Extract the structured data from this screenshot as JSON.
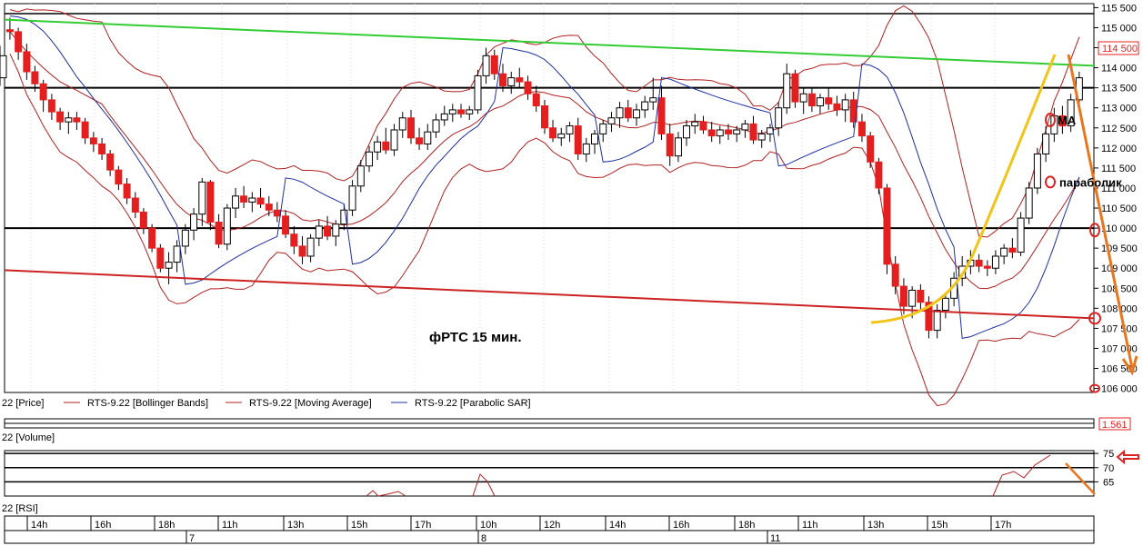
{
  "chart_data": [
    {
      "type": "candlestick",
      "panel": "price",
      "title": "фРТС   15 мин.",
      "y_ticks": [
        106000,
        106500,
        107000,
        107500,
        108000,
        108500,
        109000,
        109500,
        110000,
        110500,
        111000,
        111500,
        112000,
        112500,
        113000,
        113500,
        114000,
        114500,
        115000,
        115500
      ],
      "y_tick_labels": [
        "106 000",
        "106 500",
        "107 000",
        "107 500",
        "108 000",
        "108 500",
        "109 000",
        "109 500",
        "110 000",
        "110 500",
        "111 000",
        "111 500",
        "112 000",
        "112 500",
        "113 000",
        "113 500",
        "114 000",
        "114 500",
        "115 000",
        "115 500"
      ],
      "ylim": [
        105900,
        115600
      ],
      "last_price_label": "114 500",
      "last_price": 114500,
      "horizontal_levels": [
        115350,
        113500,
        110000
      ],
      "trendlines": [
        {
          "color": "#33cc33",
          "from": [
            0,
            115200
          ],
          "to": [
            158,
            114050
          ]
        },
        {
          "color": "#cc2222",
          "from": [
            0,
            108950
          ],
          "to": [
            158,
            107750
          ]
        }
      ],
      "series_legend": [
        {
          "name": "22 [Price]"
        },
        {
          "name": "RTS-9.22 [Bollinger Bands]",
          "color": "#b02020"
        },
        {
          "name": "RTS-9.22 [Moving Average]",
          "color": "#b02020"
        },
        {
          "name": "RTS-9.22 [Parabolic SAR]",
          "color": "#1f2fa0"
        }
      ],
      "annotations": [
        {
          "text": "МА",
          "x": 151,
          "y": 112700
        },
        {
          "text": "параболик",
          "x": 151,
          "y": 111150
        }
      ],
      "candles_ohlc": [
        [
          114950,
          115250,
          114700,
          114900
        ],
        [
          114900,
          115000,
          114200,
          114400
        ],
        [
          114400,
          114600,
          113700,
          113900
        ],
        [
          113900,
          114050,
          113400,
          113600
        ],
        [
          113600,
          113700,
          112900,
          113200
        ],
        [
          113200,
          113350,
          112700,
          112900
        ],
        [
          112900,
          113000,
          112450,
          112650
        ],
        [
          112650,
          112900,
          112350,
          112750
        ],
        [
          112750,
          112900,
          112450,
          112650
        ],
        [
          112650,
          112750,
          112100,
          112250
        ],
        [
          112250,
          112400,
          111900,
          112100
        ],
        [
          112100,
          112250,
          111700,
          111850
        ],
        [
          111850,
          111950,
          111300,
          111450
        ],
        [
          111450,
          111550,
          110950,
          111100
        ],
        [
          111100,
          111250,
          110600,
          110750
        ],
        [
          110750,
          110900,
          110250,
          110400
        ],
        [
          110400,
          110500,
          109850,
          110000
        ],
        [
          110000,
          110100,
          109400,
          109500
        ],
        [
          109500,
          109600,
          108900,
          109000
        ],
        [
          109000,
          109400,
          108600,
          109150
        ],
        [
          109150,
          109700,
          108900,
          109550
        ],
        [
          109550,
          110100,
          109350,
          109950
        ],
        [
          109950,
          110500,
          109700,
          110350
        ],
        [
          110350,
          111250,
          110050,
          111150
        ],
        [
          111150,
          111200,
          109950,
          110150
        ],
        [
          110150,
          110350,
          109500,
          109600
        ],
        [
          109600,
          110600,
          109450,
          110500
        ],
        [
          110500,
          111000,
          110250,
          110800
        ],
        [
          110800,
          111050,
          110500,
          110650
        ],
        [
          110650,
          110900,
          110400,
          110750
        ],
        [
          110750,
          111000,
          110500,
          110600
        ],
        [
          110600,
          110800,
          110300,
          110450
        ],
        [
          110450,
          110650,
          110150,
          110300
        ],
        [
          110300,
          110450,
          109750,
          109850
        ],
        [
          109850,
          110050,
          109350,
          109550
        ],
        [
          109550,
          109800,
          109100,
          109300
        ],
        [
          109300,
          109850,
          109150,
          109750
        ],
        [
          109750,
          110200,
          109550,
          110050
        ],
        [
          110050,
          110300,
          109700,
          109800
        ],
        [
          109800,
          110200,
          109550,
          110100
        ],
        [
          110100,
          110600,
          109950,
          110450
        ],
        [
          110450,
          111200,
          110300,
          111050
        ],
        [
          111050,
          111700,
          110900,
          111550
        ],
        [
          111550,
          112050,
          111400,
          111900
        ],
        [
          111900,
          112300,
          111700,
          112150
        ],
        [
          112150,
          112500,
          111850,
          111950
        ],
        [
          111950,
          112600,
          111800,
          112450
        ],
        [
          112450,
          112900,
          112250,
          112750
        ],
        [
          112750,
          112950,
          112100,
          112250
        ],
        [
          112250,
          112500,
          111950,
          112100
        ],
        [
          112100,
          112600,
          111950,
          112400
        ],
        [
          112400,
          112850,
          112250,
          112700
        ],
        [
          112700,
          113050,
          112550,
          112850
        ],
        [
          112850,
          113100,
          112650,
          112950
        ],
        [
          112950,
          113100,
          112750,
          112850
        ],
        [
          112850,
          113050,
          112700,
          112950
        ],
        [
          112950,
          113950,
          112850,
          113800
        ],
        [
          113800,
          114500,
          113600,
          114300
        ],
        [
          114300,
          114450,
          113700,
          113850
        ],
        [
          113850,
          114100,
          113400,
          113550
        ],
        [
          113550,
          113900,
          113350,
          113750
        ],
        [
          113750,
          114000,
          113500,
          113650
        ],
        [
          113650,
          113800,
          113200,
          113350
        ],
        [
          113350,
          113550,
          112900,
          113050
        ],
        [
          113050,
          113200,
          112350,
          112500
        ],
        [
          112500,
          112700,
          112150,
          112250
        ],
        [
          112250,
          112500,
          112050,
          112350
        ],
        [
          112350,
          112650,
          112150,
          112550
        ],
        [
          112550,
          112750,
          111700,
          111850
        ],
        [
          111850,
          112250,
          111650,
          112100
        ],
        [
          112100,
          112450,
          111850,
          112350
        ],
        [
          112350,
          112700,
          112150,
          112600
        ],
        [
          112600,
          112900,
          112400,
          112750
        ],
        [
          112750,
          113150,
          112500,
          113000
        ],
        [
          113000,
          113200,
          112650,
          112750
        ],
        [
          112750,
          113100,
          112550,
          112950
        ],
        [
          112950,
          113300,
          112750,
          113150
        ],
        [
          113150,
          113750,
          112950,
          113250
        ],
        [
          113250,
          113550,
          112200,
          112350
        ],
        [
          112350,
          112600,
          111550,
          111800
        ],
        [
          111800,
          112400,
          111650,
          112250
        ],
        [
          112250,
          112700,
          112050,
          112550
        ],
        [
          112550,
          112850,
          112350,
          112650
        ],
        [
          112650,
          112800,
          112350,
          112450
        ],
        [
          112450,
          112650,
          112150,
          112300
        ],
        [
          112300,
          112550,
          112100,
          112450
        ],
        [
          112450,
          112600,
          112200,
          112350
        ],
        [
          112350,
          112550,
          112150,
          112450
        ],
        [
          112450,
          112700,
          112250,
          112600
        ],
        [
          112600,
          112800,
          112100,
          112200
        ],
        [
          112200,
          112450,
          112000,
          112350
        ],
        [
          112350,
          112600,
          112150,
          112500
        ],
        [
          112500,
          113150,
          112300,
          113000
        ],
        [
          113000,
          114100,
          112850,
          113850
        ],
        [
          113850,
          113950,
          113000,
          113150
        ],
        [
          113150,
          113500,
          112850,
          113350
        ],
        [
          113350,
          113500,
          112900,
          113050
        ],
        [
          113050,
          113350,
          112850,
          113250
        ],
        [
          113250,
          113500,
          112950,
          113100
        ],
        [
          113100,
          113300,
          112800,
          112950
        ],
        [
          112950,
          113350,
          112650,
          113200
        ],
        [
          113200,
          113400,
          112500,
          112650
        ],
        [
          112650,
          112850,
          112150,
          112300
        ],
        [
          112300,
          112400,
          111500,
          111650
        ],
        [
          111650,
          111750,
          110850,
          111000
        ],
        [
          111000,
          111100,
          108850,
          109100
        ],
        [
          109100,
          109300,
          108350,
          108550
        ],
        [
          108550,
          108750,
          107850,
          108050
        ],
        [
          108050,
          108550,
          107750,
          108450
        ],
        [
          108450,
          108600,
          107950,
          108150
        ],
        [
          108150,
          108300,
          107250,
          107450
        ],
        [
          107450,
          108100,
          107250,
          107950
        ],
        [
          107950,
          108400,
          107750,
          108250
        ],
        [
          108250,
          108900,
          108050,
          108750
        ],
        [
          108750,
          109300,
          108550,
          109050
        ],
        [
          109050,
          109450,
          108850,
          109200
        ],
        [
          109200,
          109350,
          108900,
          109050
        ],
        [
          109050,
          109200,
          108800,
          109000
        ],
        [
          109000,
          109450,
          108850,
          109300
        ],
        [
          109300,
          109600,
          109100,
          109500
        ],
        [
          109500,
          109750,
          109250,
          109400
        ],
        [
          109400,
          110400,
          109300,
          110250
        ],
        [
          110250,
          111150,
          110100,
          111000
        ],
        [
          111000,
          112000,
          110850,
          111850
        ],
        [
          111850,
          112550,
          111650,
          112350
        ],
        [
          112350,
          113000,
          112150,
          112800
        ],
        [
          112800,
          113050,
          112350,
          112550
        ],
        [
          112550,
          113350,
          112400,
          113200
        ],
        [
          113200,
          113900,
          113000,
          113750
        ],
        [
          113750,
          114550,
          113550,
          114300
        ]
      ],
      "x_candle_positions": [
        0.05,
        0.56,
        1.07,
        1.57,
        2.08,
        2.59,
        3.1,
        3.61,
        4.11,
        4.62,
        5.13,
        5.64,
        6.14,
        6.65,
        7.16,
        7.67,
        8.17,
        8.68,
        9.19,
        9.7,
        10.2,
        10.71,
        11.22,
        11.73,
        12.23,
        12.74,
        13.25,
        13.76,
        14.26,
        14.77,
        15.28,
        15.79,
        16.29,
        16.8,
        17.31,
        17.82,
        18.32,
        18.83,
        19.34,
        19.85,
        20.35,
        20.86,
        21.37,
        21.88,
        22.38,
        22.89,
        23.4,
        23.91,
        24.42,
        24.92,
        25.43,
        25.94,
        26.45,
        26.95,
        27.46,
        27.97,
        28.48,
        28.98,
        29.49,
        30.0,
        30.51,
        31.01,
        31.52,
        32.03,
        32.54,
        33.04,
        33.55,
        34.06,
        34.57,
        35.07,
        35.58,
        36.09,
        36.6,
        37.1,
        37.61,
        38.12,
        38.63,
        39.13,
        39.64,
        40.15,
        40.66,
        41.16,
        41.67,
        42.18,
        42.69,
        43.19,
        43.7,
        44.21,
        44.72,
        45.22,
        45.73,
        46.24,
        46.75,
        47.25,
        47.76,
        48.27,
        48.78,
        49.28,
        49.79,
        50.3,
        50.81,
        51.31,
        51.82,
        52.33,
        52.84,
        53.34,
        53.85,
        54.36,
        54.87,
        55.38,
        55.88,
        56.39,
        56.9,
        57.41,
        57.91,
        58.42,
        58.93,
        59.44,
        59.94,
        60.45,
        60.96,
        61.47,
        61.97,
        62.48,
        62.99,
        63.5,
        64.0,
        64.51,
        65.02
      ]
    },
    {
      "type": "line",
      "panel": "volume",
      "title": "22 [Volume]",
      "last_value_label": "1.561",
      "last_value": 1.561
    },
    {
      "type": "line",
      "panel": "rsi",
      "title": "22 [RSI]",
      "y_ticks": [
        65,
        70,
        75
      ],
      "y_tick_labels": [
        "65",
        "70",
        "75"
      ],
      "ylim": [
        60,
        76
      ],
      "levels": [
        65,
        70,
        75
      ]
    }
  ],
  "x_axis": {
    "hour_labels": [
      "14h",
      "16h",
      "18h",
      "11h",
      "13h",
      "15h",
      "17h",
      "10h",
      "12h",
      "14h",
      "16h",
      "18h",
      "11h",
      "13h",
      "15h",
      "17h"
    ],
    "day_labels": [
      "7",
      "8",
      "11"
    ]
  },
  "colors": {
    "up_candle": "#ffffff",
    "down_candle": "#e41f1f",
    "bollinger": "#b02020",
    "ma": "#b02020",
    "psar": "#1f2fa0",
    "resistance_line": "#33cc33",
    "support_line": "#cc2222",
    "parabola": "#f0c419",
    "forecast_arrow": "#e8761e",
    "marker": "#dd2222"
  }
}
